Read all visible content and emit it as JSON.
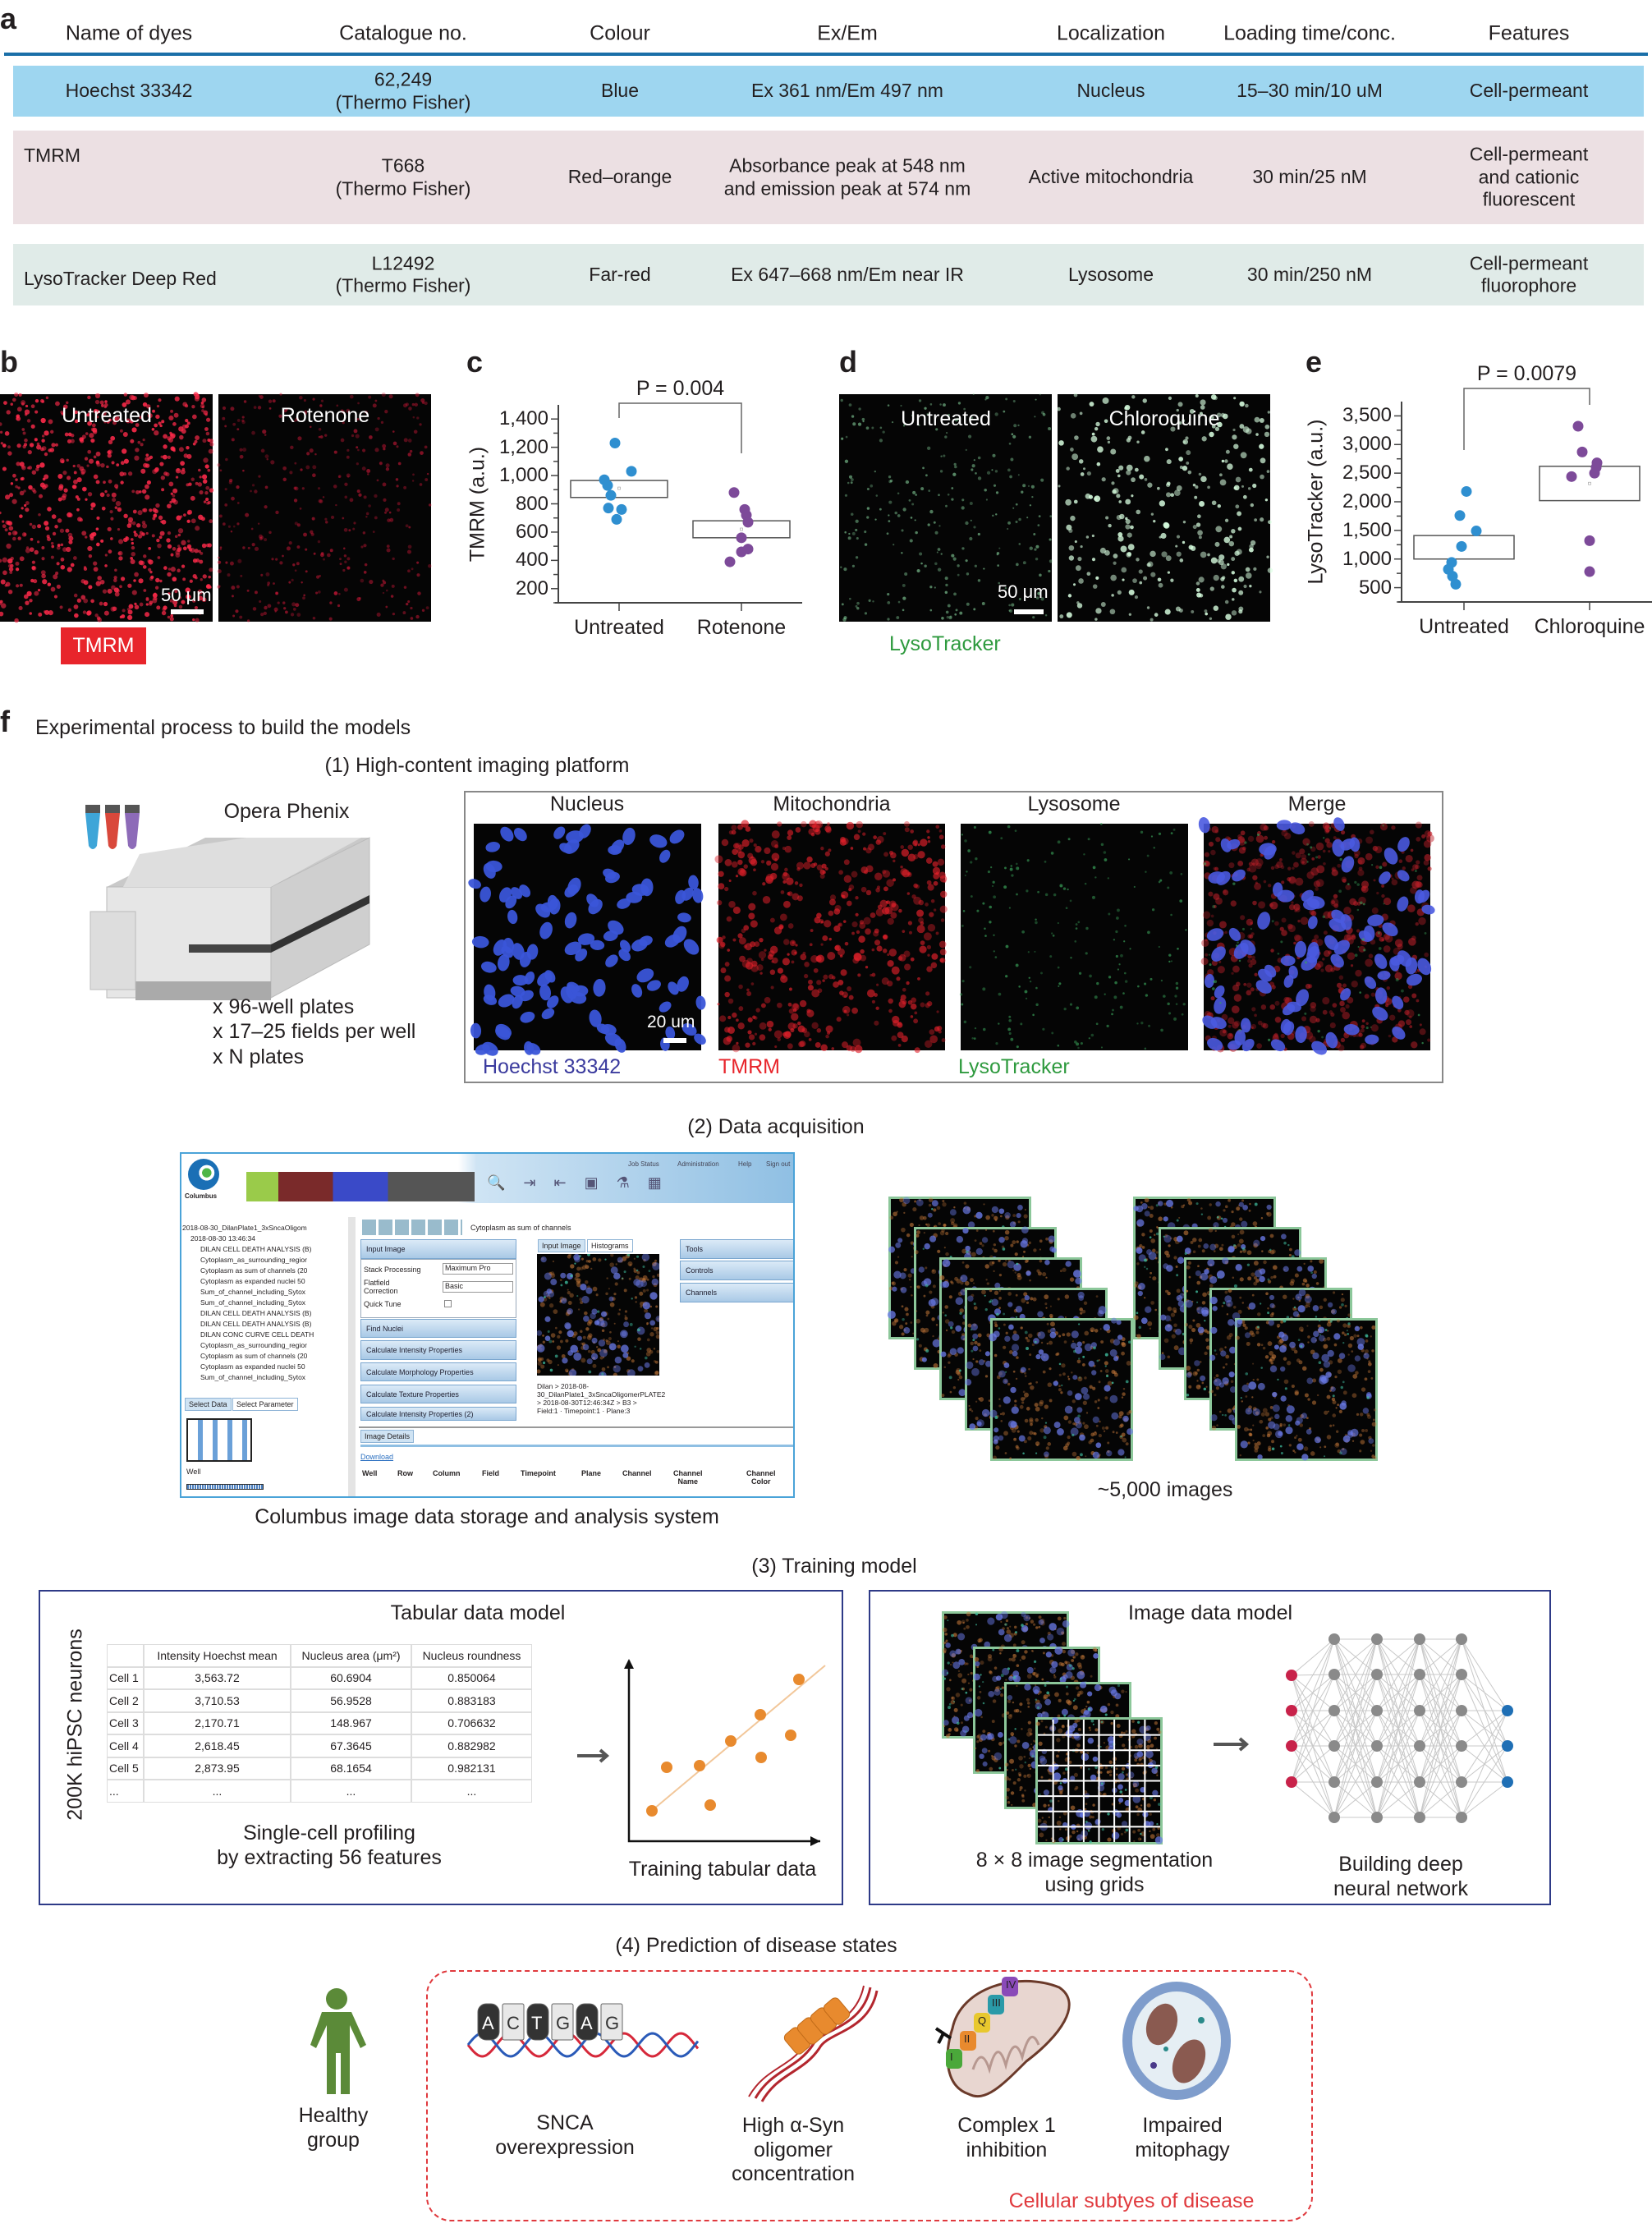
{
  "panel_labels": {
    "a": "a",
    "b": "b",
    "c": "c",
    "d": "d",
    "e": "e",
    "f": "f"
  },
  "table_a": {
    "headers": [
      "Name of dyes",
      "Catalogue no.",
      "Colour",
      "Ex/Em",
      "Localization",
      "Loading time/conc.",
      "Features"
    ],
    "rows": [
      {
        "color": "#9ed6f0",
        "cells": [
          "Hoechst 33342",
          "62,249\n(Thermo Fisher)",
          "Blue",
          "Ex 361 nm/Em 497 nm",
          "Nucleus",
          "15–30 min/10 uM",
          "Cell-permeant"
        ]
      },
      {
        "color": "#ece0e3",
        "cells": [
          "TMRM",
          "T668\n(Thermo Fisher)",
          "Red–orange",
          "Absorbance peak at 548 nm\nand emission peak at 574 nm",
          "Active mitochondria",
          "30 min/25 nM",
          "Cell-permeant\nand cationic fluorescent"
        ]
      },
      {
        "color": "#e0ebe8",
        "cells": [
          "LysoTracker Deep Red",
          "L12492\n(Thermo Fisher)",
          "Far-red",
          "Ex 647–668 nm/Em near IR",
          "Lysosome",
          "30 min/250 nM",
          "Cell-permeant\nfluorophore"
        ]
      }
    ],
    "rule_color": "#1a6fa8"
  },
  "panel_b": {
    "images": [
      "Untreated",
      "Rotenone"
    ],
    "scale_bar": "50 μm",
    "dye_label": "TMRM",
    "dye_color": "#e8252b"
  },
  "panel_d": {
    "images": [
      "Untreated",
      "Chloroquine"
    ],
    "scale_bar": "50 μm",
    "dye_label": "LysoTracker",
    "dye_color": "#2e9a3e"
  },
  "chart_data": [
    {
      "panel": "c",
      "type": "scatter",
      "title": "",
      "stat_label": "P = 0.004",
      "ylabel": "TMRM (a.u.)",
      "xlabel": "",
      "categories": [
        "Untreated",
        "Rotenone"
      ],
      "yticks": [
        "200",
        "400",
        "600",
        "800",
        "1,000",
        "1,200",
        "1,400"
      ],
      "ytick_values": [
        200,
        400,
        600,
        800,
        1000,
        1200,
        1400
      ],
      "ylim": [
        100,
        1500
      ],
      "grid": false,
      "series": [
        {
          "category": "Untreated",
          "color": "#2f8fd0",
          "values": [
            1230,
            1030,
            970,
            930,
            860,
            770,
            760,
            690
          ],
          "box": [
            845,
            965
          ],
          "mean": 910
        },
        {
          "category": "Rotenone",
          "color": "#7d4a99",
          "values": [
            880,
            760,
            720,
            670,
            560,
            480,
            460,
            390
          ],
          "box": [
            560,
            680
          ],
          "mean": 620
        }
      ]
    },
    {
      "panel": "e",
      "type": "scatter",
      "title": "",
      "stat_label": "P = 0.0079",
      "ylabel": "LysoTracker (a.u.)",
      "xlabel": "",
      "categories": [
        "Untreated",
        "Chloroquine"
      ],
      "yticks": [
        "500",
        "1,000",
        "1,500",
        "2,000",
        "2,500",
        "3,000",
        "3,500"
      ],
      "ytick_values": [
        500,
        1000,
        1500,
        2000,
        2500,
        3000,
        3500
      ],
      "ylim": [
        250,
        3750
      ],
      "grid": false,
      "series": [
        {
          "category": "Untreated",
          "color": "#2f8fd0",
          "values": [
            2180,
            1760,
            1490,
            1220,
            940,
            820,
            700,
            560
          ],
          "box": [
            1000,
            1410
          ],
          "mean": 1200
        },
        {
          "category": "Chloroquine",
          "color": "#7d4a99",
          "values": [
            3320,
            2870,
            2680,
            2600,
            2500,
            2440,
            1320,
            780
          ],
          "box": [
            2020,
            2620
          ],
          "mean": 2320
        }
      ]
    }
  ],
  "panel_f": {
    "title": "Experimental process to build the models",
    "step1": {
      "title": "(1) High-content imaging platform",
      "instrument": "Opera Phenix",
      "specs": [
        "x 96-well plates",
        "x 17–25 fields per well",
        "x N plates"
      ],
      "channels": [
        {
          "label": "Nucleus",
          "dye": "Hoechst 33342",
          "dye_color": "#3b3b9e"
        },
        {
          "label": "Mitochondria",
          "dye": "TMRM",
          "dye_color": "#e8252b"
        },
        {
          "label": "Lysosome",
          "dye": "LysoTracker",
          "dye_color": "#2e9a3e"
        },
        {
          "label": "Merge",
          "dye": "",
          "dye_color": ""
        }
      ],
      "scale_bar": "20 um"
    },
    "step2": {
      "title": "(2) Data acquisition",
      "software_caption": "Columbus image data storage and analysis system",
      "images_caption": "~5,000 images",
      "columbus": {
        "logo": "Columbus",
        "links": [
          "Job Status",
          "Administration",
          "Help",
          "Sign out"
        ],
        "tree": [
          "2018-08-30_DilanPlate1_3xSncaOligom",
          "2018-08-30 13:46:34",
          "DILAN CELL DEATH ANALYSIS (B)",
          "Cytoplasm_as_surrounding_regior",
          "Cytoplasm as sum of channels (20",
          "Cytoplasm as expanded nuclei 50",
          "Sum_of_channel_including_Sytox",
          "Sum_of_channel_including_Sytox",
          "DILAN CELL DEATH ANALYSIS (B)",
          "DILAN CELL DEATH ANALYSIS (B)",
          "DILAN CONC CURVE CELL DEATH",
          "Cytoplasm_as_surrounding_regior",
          "Cytoplasm as sum of channels (20",
          "Cytoplasm as expanded nuclei 50",
          "Sum_of_channel_including_Sytox"
        ],
        "left_tabs": [
          "Select Data",
          "Select Parameter"
        ],
        "well_label": "Well",
        "analysis_name": "Cytoplasm as sum of channels",
        "input_image": "Input Image",
        "stack_processing": "Stack Processing",
        "stack_value": "Maximum Pro",
        "flatfield": "Flatfield\nCorrection",
        "flatfield_value": "Basic",
        "quick_tune": "Quick Tune",
        "steps": [
          "Find Nuclei",
          "Calculate Intensity Properties",
          "Calculate Morphology Properties",
          "Calculate Texture Properties",
          "Calculate Intensity Properties (2)"
        ],
        "image_tabs": [
          "Input Image",
          "Histograms"
        ],
        "breadcrumb": "Dilan > 2018-08-\n30_DilanPlate1_3xSncaOligomerPLATE2\n> 2018-08-30T12:46:34Z > B3 >\nField:1 · Timepoint:1 · Plane:3",
        "side_buttons": [
          "Tools",
          "Controls",
          "Channels"
        ],
        "details_tab": "Image Details",
        "download": "Download",
        "columns": [
          "Well",
          "Row",
          "Column",
          "Field",
          "Timepoint",
          "Plane",
          "Channel",
          "Channel\nName",
          "Channel\nColor"
        ]
      }
    },
    "step3": {
      "title": "(3) Training model",
      "tabular": {
        "title": "Tabular data model",
        "side_label": "200K hiPSC neurons",
        "table_headers": [
          "",
          "Intensity Hoechst mean",
          "Nucleus area (μm²)",
          "Nucleus roundness"
        ],
        "table_rows": [
          [
            "Cell 1",
            "3,563.72",
            "60.6904",
            "0.850064"
          ],
          [
            "Cell 2",
            "3,710.53",
            "56.9528",
            "0.883183"
          ],
          [
            "Cell 3",
            "2,170.71",
            "148.967",
            "0.706632"
          ],
          [
            "Cell 4",
            "2,618.45",
            "67.3645",
            "0.882982"
          ],
          [
            "Cell 5",
            "2,873.95",
            "68.1654",
            "0.982131"
          ],
          [
            "...",
            "...",
            "...",
            "..."
          ]
        ],
        "caption": "Single-cell profiling\nby extracting 56 features",
        "plot_caption": "Training tabular data"
      },
      "image": {
        "title": "Image data model",
        "grid_caption": "8 × 8 image segmentation\nusing grids",
        "nn_caption": "Building deep\nneural network"
      }
    },
    "step4": {
      "title": "(4) Prediction of disease states",
      "healthy": "Healthy\ngroup",
      "dna_letters": [
        "A",
        "C",
        "T",
        "G",
        "A",
        "G"
      ],
      "subtypes": [
        "SNCA\noverexpression",
        "High α-Syn\noligomer\nconcentration",
        "Complex 1\ninhibition",
        "Impaired\nmitophagy"
      ],
      "complex_labels": [
        "I",
        "II",
        "Q",
        "III",
        "IV"
      ],
      "box_label": "Cellular subtyes of disease",
      "box_color": "#e03a3e"
    }
  }
}
